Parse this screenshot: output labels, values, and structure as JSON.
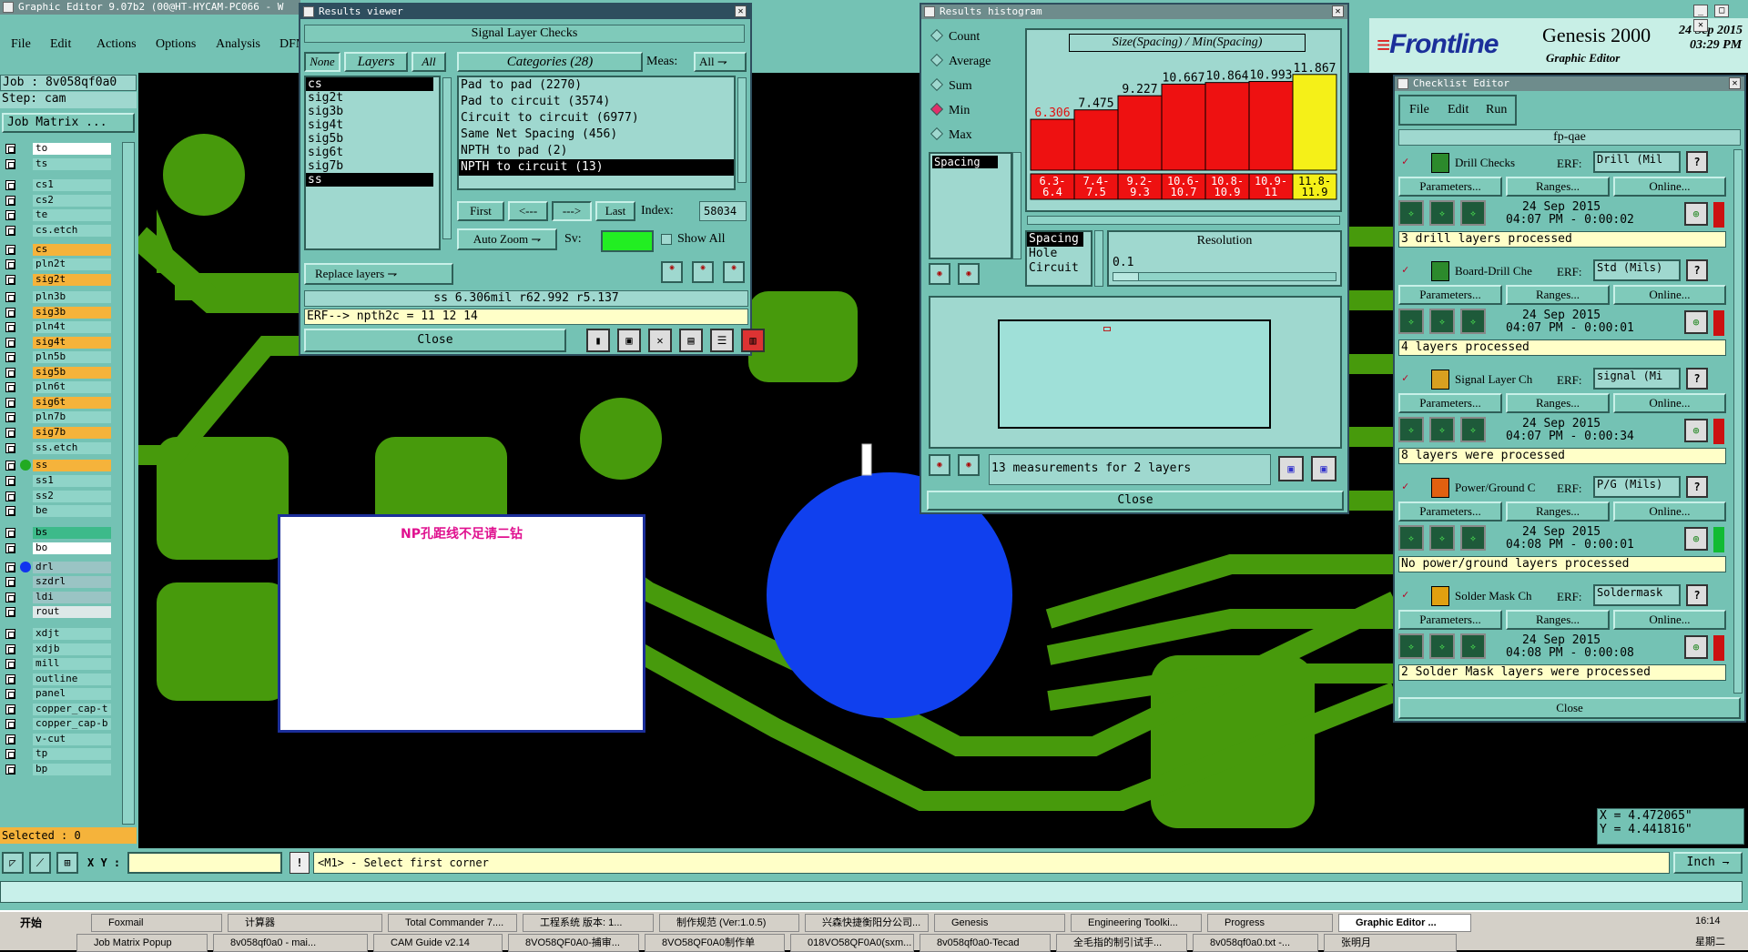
{
  "main_title": "Graphic Editor 9.07b2 (00@HT-HYCAM-PC066 - W",
  "menu": [
    "File",
    "Edit",
    "Actions",
    "Options",
    "Analysis",
    "DFM"
  ],
  "job_label": "Job : 8v058qf0a0",
  "step_label": "Step: cam",
  "job_matrix_label": "Job Matrix ...",
  "layers": [
    {
      "name": "to",
      "color": "c-white"
    },
    {
      "name": "ts",
      "color": "c-teal"
    },
    {
      "name": "cs1",
      "color": "c-teal"
    },
    {
      "name": "cs2",
      "color": "c-teal"
    },
    {
      "name": "te",
      "color": "c-teal"
    },
    {
      "name": "cs.etch",
      "color": "c-teal"
    },
    {
      "name": "cs",
      "color": "c-orange"
    },
    {
      "name": "pln2t",
      "color": "c-teal"
    },
    {
      "name": "sig2t",
      "color": "c-orange"
    },
    {
      "name": "pln3b",
      "color": "c-teal"
    },
    {
      "name": "sig3b",
      "color": "c-orange"
    },
    {
      "name": "pln4t",
      "color": "c-teal"
    },
    {
      "name": "sig4t",
      "color": "c-orange"
    },
    {
      "name": "pln5b",
      "color": "c-teal"
    },
    {
      "name": "sig5b",
      "color": "c-orange"
    },
    {
      "name": "pln6t",
      "color": "c-teal"
    },
    {
      "name": "sig6t",
      "color": "c-orange"
    },
    {
      "name": "pln7b",
      "color": "c-teal"
    },
    {
      "name": "sig7b",
      "color": "c-orange"
    },
    {
      "name": "ss.etch",
      "color": "c-teal"
    },
    {
      "name": "ss",
      "color": "c-orange"
    },
    {
      "name": "ss1",
      "color": "c-teal"
    },
    {
      "name": "ss2",
      "color": "c-teal"
    },
    {
      "name": "be",
      "color": "c-teal"
    },
    {
      "name": "bs",
      "color": "c-green"
    },
    {
      "name": "bo",
      "color": "c-white"
    },
    {
      "name": "drl",
      "color": "c-gray"
    },
    {
      "name": "szdrl",
      "color": "c-gray"
    },
    {
      "name": "ldi",
      "color": "c-gray"
    },
    {
      "name": "rout",
      "color": "c-lgray"
    },
    {
      "name": "xdjt",
      "color": "c-teal"
    },
    {
      "name": "xdjb",
      "color": "c-teal"
    },
    {
      "name": "mill",
      "color": "c-teal"
    },
    {
      "name": "outline",
      "color": "c-teal"
    },
    {
      "name": "panel",
      "color": "c-teal"
    },
    {
      "name": "copper_cap-t",
      "color": "c-teal"
    },
    {
      "name": "copper_cap-b",
      "color": "c-teal"
    },
    {
      "name": "v-cut",
      "color": "c-teal"
    },
    {
      "name": "tp",
      "color": "c-teal"
    },
    {
      "name": "bp",
      "color": "c-teal"
    }
  ],
  "selected_label": "Selected : 0",
  "xy_label": "X Y :",
  "prompt_text": "<M1> - Select first corner",
  "unit_label": "Inch",
  "coord_x": "X = 4.472065\"",
  "coord_y": "Y = 4.441816\"",
  "note_text": "NP孔距线不足请二钻",
  "results_viewer": {
    "title": "Results viewer",
    "header": "Signal Layer Checks",
    "none_btn": "None",
    "layers_btn": "Layers",
    "all_btn": "All",
    "layers": [
      "cs",
      "sig2t",
      "sig3b",
      "sig4t",
      "sig5b",
      "sig6t",
      "sig7b",
      "ss"
    ],
    "categories_label": "Categories (28)",
    "meas_label": "Meas:",
    "meas_value": "All",
    "categories": [
      "Pad to pad (2270)",
      "Pad to circuit (3574)",
      "Circuit to circuit (6977)",
      "Same Net Spacing (456)",
      "NPTH to pad (2)",
      "NPTH to circuit (13)"
    ],
    "first_btn": "First",
    "prev_btn": "<---",
    "next_btn": "--->",
    "last_btn": "Last",
    "index_label": "Index:",
    "index_value": "58034",
    "auto_zoom": "Auto Zoom",
    "sv_label": "Sv:",
    "show_all": "Show All",
    "replace_layers": "Replace layers",
    "status1": "ss 6.306mil   r62.992   r5.137",
    "status2": "ERF--> npth2c = 11 12 14",
    "close": "Close"
  },
  "histogram": {
    "title": "Results histogram",
    "options": [
      "Count",
      "Average",
      "Sum",
      "Min",
      "Max"
    ],
    "selected_option": "Min",
    "header": "Size(Spacing) / Min(Spacing)",
    "list": [
      "Spacing"
    ],
    "types": [
      "Spacing",
      "Hole",
      "Circuit"
    ],
    "resolution_label": "Resolution",
    "resolution_value": "0.1",
    "summary": "13 measurements for 2 layers",
    "close": "Close"
  },
  "chart_data": {
    "type": "bar",
    "categories": [
      "6.3-6.4",
      "7.4-7.5",
      "9.2-9.3",
      "10.6-10.7",
      "10.8-10.9",
      "10.9-11",
      "11.8-11.9"
    ],
    "values": [
      6.306,
      7.475,
      9.227,
      10.667,
      10.864,
      10.993,
      11.867
    ],
    "value_labels": [
      "6.306",
      "7.475",
      "9.227",
      "10.667",
      "10.864",
      "10.993",
      "11.867"
    ],
    "tick_labels": [
      "6.3-\n6.4",
      "7.4-\n7.5",
      "9.2-\n9.3",
      "10.6-\n10.7",
      "10.8-\n10.9",
      "10.9-\n11",
      "11.8-\n11.9"
    ],
    "colors": [
      "#ee1111",
      "#ee1111",
      "#ee1111",
      "#ee1111",
      "#ee1111",
      "#ee1111",
      "#f5f018"
    ],
    "ylim": [
      0,
      12
    ]
  },
  "brand": {
    "logo": "Frontline",
    "product": "Genesis 2000",
    "subtitle": "Graphic Editor",
    "date": "24 Sep 2015",
    "time": "03:29 PM"
  },
  "checklist": {
    "title": "Checklist Editor",
    "menu": [
      "File",
      "Edit",
      "Run"
    ],
    "name": "fp-qae",
    "params_btn": "Parameters...",
    "ranges_btn": "Ranges...",
    "online_btn": "Online...",
    "erf_label": "ERF:",
    "items": [
      {
        "name": "Drill Checks",
        "erf": "Drill (Mil",
        "date": "24 Sep 2015",
        "time": "04:07 PM - 0:00:02",
        "status": "3 drill layers processed",
        "flag": "#cc1111"
      },
      {
        "name": "Board-Drill Che",
        "erf": "Std (Mils)",
        "date": "24 Sep 2015",
        "time": "04:07 PM - 0:00:01",
        "status": "4 layers processed",
        "flag": "#cc1111"
      },
      {
        "name": "Signal Layer Ch",
        "erf": "signal (Mi",
        "date": "24 Sep 2015",
        "time": "04:07 PM - 0:00:34",
        "status": "8 layers were processed",
        "flag": "#cc1111"
      },
      {
        "name": "Power/Ground C",
        "erf": "P/G (Mils)",
        "date": "24 Sep 2015",
        "time": "04:08 PM - 0:00:01",
        "status": "No power/ground layers processed",
        "flag": "#11bb33"
      },
      {
        "name": "Solder Mask Ch",
        "erf": "Soldermask",
        "date": "24 Sep 2015",
        "time": "04:08 PM - 0:00:08",
        "status": "2 Solder Mask layers were processed",
        "flag": "#cc1111"
      }
    ],
    "close": "Close"
  },
  "taskbar": {
    "start": "开始",
    "row1": [
      "Foxmail",
      "计算器",
      "Total Commander 7....",
      "工程系统   版本: 1...",
      "制作规范 (Ver:1.0.5)",
      "兴森快捷衡阳分公司...",
      "Genesis",
      "Engineering Toolki...",
      "Progress",
      "Graphic Editor ..."
    ],
    "row2": [
      "Job Matrix Popup",
      "8v058qf0a0 - mai...",
      "CAM Guide v2.14",
      "8VO58QF0A0-捕审...",
      "8VO58QF0A0制作单",
      "018VO58QF0A0(sxm...",
      "8v058qf0a0-Tecad",
      "全毛指的制引试手...",
      "8v058qf0a0.txt -...",
      "张明月"
    ],
    "clock": "16:14",
    "clock_day": "星期二"
  }
}
